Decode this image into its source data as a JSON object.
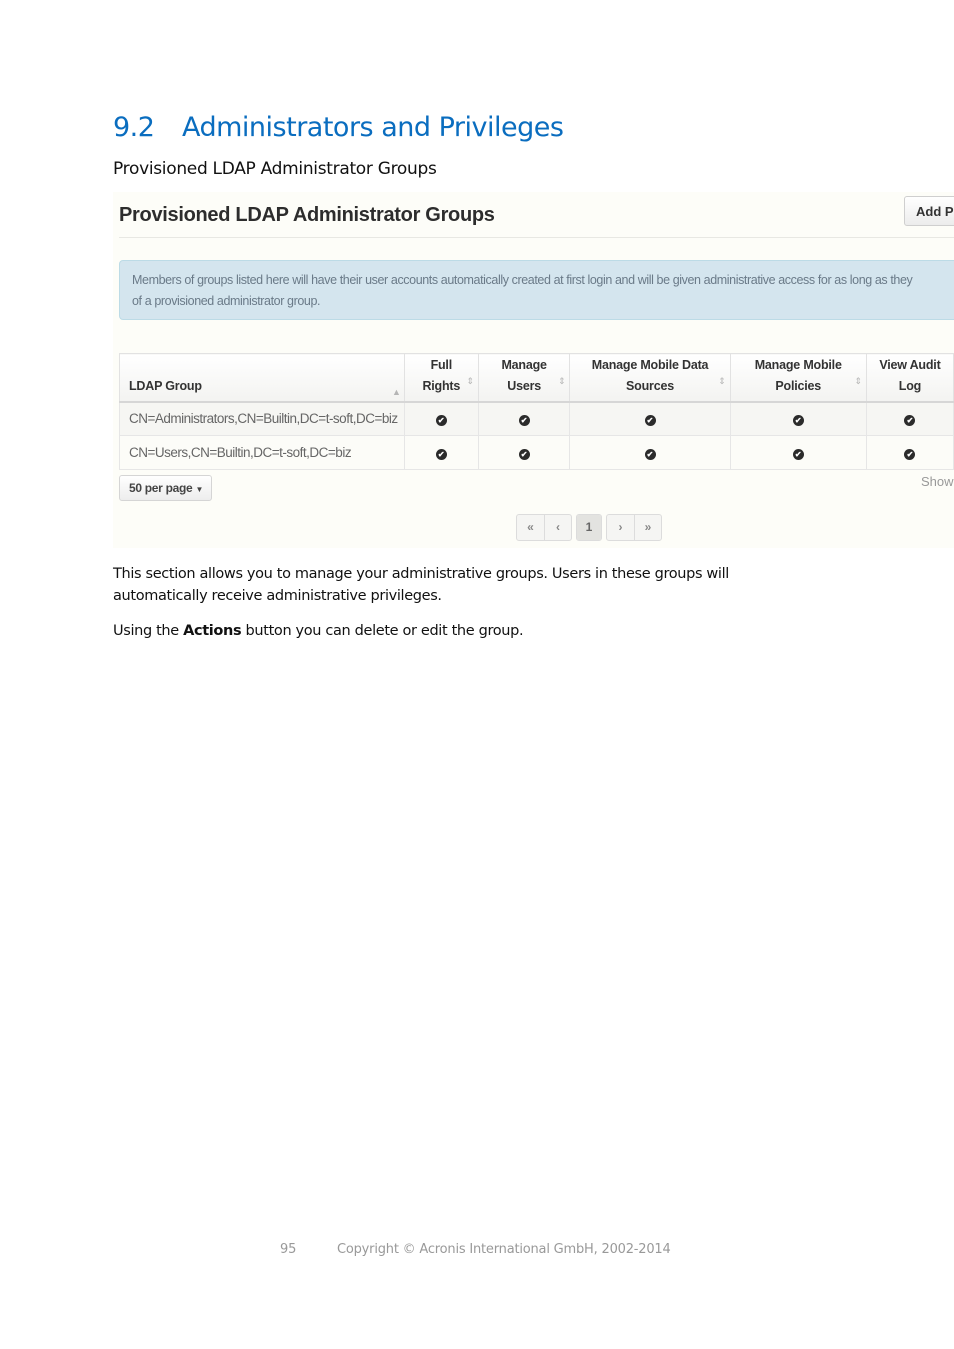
{
  "section": {
    "number": "9.2",
    "title": "Administrators and Privileges",
    "caption": "Provisioned LDAP Administrator Groups"
  },
  "screenshot": {
    "title": "Provisioned LDAP Administrator Groups",
    "add_button_label": "Add Pr",
    "info_text": "Members of groups listed here will have their user accounts automatically created at first login and will be given administrative access for as long as they are members of a provisioned administrator group.",
    "info_line1": "Members of groups listed here will have their user accounts automatically created at first login and will be given administrative access for as long as they",
    "info_line2": "of a provisioned administrator group.",
    "table": {
      "columns": [
        {
          "line1": "",
          "line2": "LDAP Group",
          "sort": "sorted-ascending"
        },
        {
          "line1": "Full",
          "line2": "Rights",
          "sort": "sortable"
        },
        {
          "line1": "Manage",
          "line2": "Users",
          "sort": "sortable"
        },
        {
          "line1": "Manage Mobile Data",
          "line2": "Sources",
          "sort": "sortable"
        },
        {
          "line1": "Manage Mobile",
          "line2": "Policies",
          "sort": "sortable"
        },
        {
          "line1": "View Audit",
          "line2": "Log",
          "sort": "sortable"
        }
      ],
      "rows": [
        {
          "group": "CN=Administrators,CN=Builtin,DC=t-soft,DC=biz",
          "full_rights": true,
          "manage_users": true,
          "manage_mobile_data_sources": true,
          "manage_mobile_policies": true,
          "view_audit_log": true
        },
        {
          "group": "CN=Users,CN=Builtin,DC=t-soft,DC=biz",
          "full_rights": true,
          "manage_users": true,
          "manage_mobile_data_sources": true,
          "manage_mobile_policies": true,
          "view_audit_log": true
        }
      ],
      "check_glyph": "✔"
    },
    "per_page_label": "50 per page",
    "showing_text": "Showi",
    "pagination": {
      "first": "«",
      "prev": "‹",
      "current": "1",
      "next": "›",
      "last": "»"
    }
  },
  "body": {
    "paragraph1": "This section allows you to manage your administrative groups. Users in these groups will automatically receive administrative privileges.",
    "paragraph2_prefix": "Using the ",
    "paragraph2_bold": "Actions",
    "paragraph2_suffix": " button you can delete or edit the group."
  },
  "footer": {
    "page_number": "95",
    "copyright": "Copyright © Acronis International GmbH, 2002-2014"
  }
}
